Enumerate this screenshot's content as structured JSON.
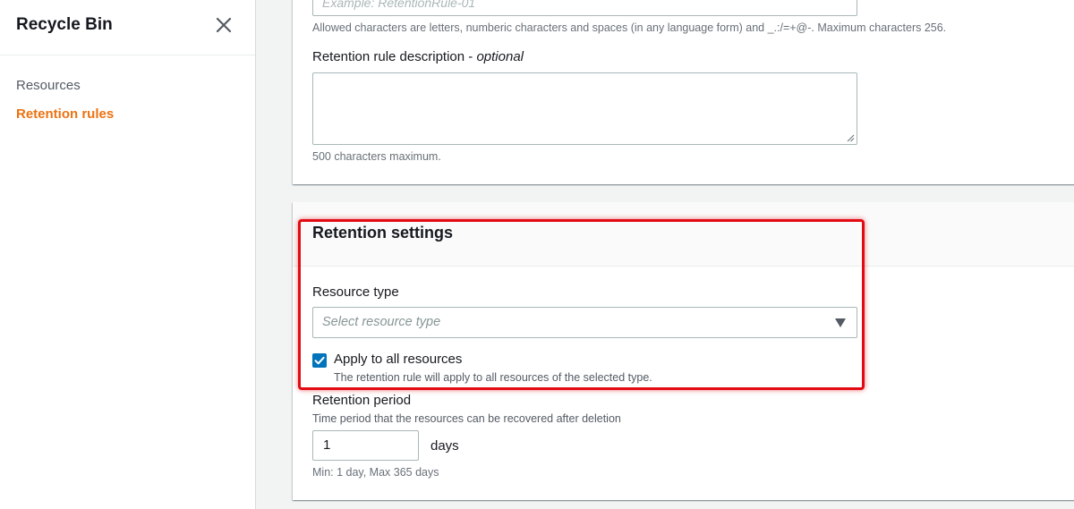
{
  "sidebar": {
    "title": "Recycle Bin",
    "items": [
      {
        "label": "Resources",
        "active": false
      },
      {
        "label": "Retention rules",
        "active": true
      }
    ]
  },
  "form": {
    "name_placeholder": "Example: RetentionRule-01",
    "name_hint": "Allowed characters are letters, numberic characters and spaces (in any language form) and _.:/=+@-. Maximum characters 256.",
    "description_label": "Retention rule description",
    "description_optional": "optional",
    "description_value": "",
    "description_hint": "500 characters maximum."
  },
  "retention_settings": {
    "title": "Retention settings",
    "resource_type_label": "Resource type",
    "resource_type_placeholder": "Select resource type",
    "apply_all_label": "Apply to all resources",
    "apply_all_checked": true,
    "apply_all_desc": "The retention rule will apply to all resources of the selected type.",
    "period_label": "Retention period",
    "period_desc": "Time period that the resources can be recovered after deletion",
    "period_value": "1",
    "period_unit": "days",
    "period_hint": "Min: 1 day, Max 365 days"
  },
  "colors": {
    "accent": "#ec7211",
    "checkbox": "#0073bb",
    "highlight": "#e20b14"
  },
  "icons": [
    "close-icon",
    "caret-down-icon",
    "checkmark-icon",
    "resize-grip-icon"
  ]
}
